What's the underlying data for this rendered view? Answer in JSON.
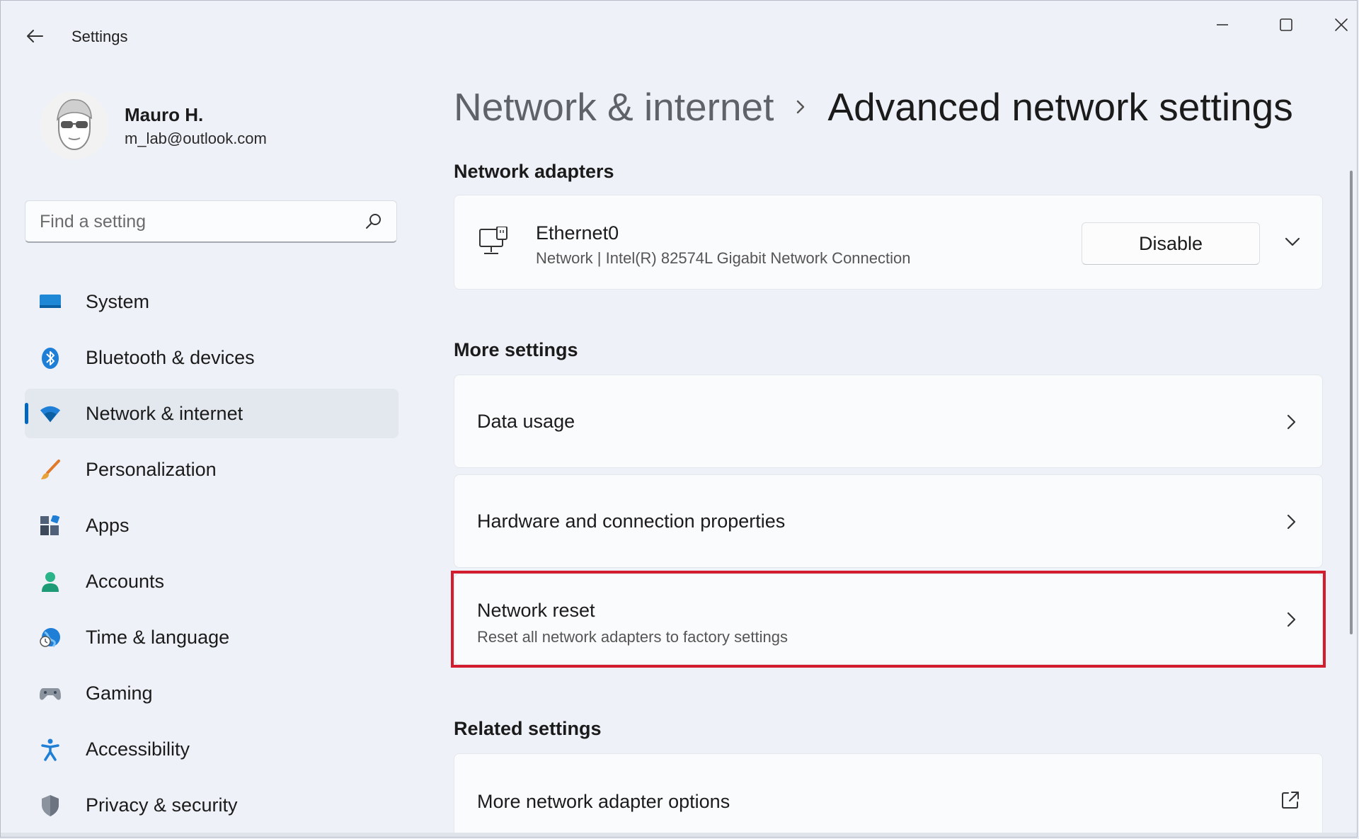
{
  "window": {
    "title": "Settings"
  },
  "profile": {
    "name": "Mauro H.",
    "email": "m_lab@outlook.com"
  },
  "search": {
    "placeholder": "Find a setting"
  },
  "sidebar": {
    "items": [
      {
        "label": "System",
        "icon": "system-icon",
        "active": false
      },
      {
        "label": "Bluetooth & devices",
        "icon": "bluetooth-icon",
        "active": false
      },
      {
        "label": "Network & internet",
        "icon": "wifi-icon",
        "active": true
      },
      {
        "label": "Personalization",
        "icon": "brush-icon",
        "active": false
      },
      {
        "label": "Apps",
        "icon": "apps-icon",
        "active": false
      },
      {
        "label": "Accounts",
        "icon": "person-icon",
        "active": false
      },
      {
        "label": "Time & language",
        "icon": "globe-clock-icon",
        "active": false
      },
      {
        "label": "Gaming",
        "icon": "gamepad-icon",
        "active": false
      },
      {
        "label": "Accessibility",
        "icon": "accessibility-icon",
        "active": false
      },
      {
        "label": "Privacy & security",
        "icon": "shield-icon",
        "active": false
      }
    ]
  },
  "breadcrumb": {
    "parent": "Network & internet",
    "current": "Advanced network settings"
  },
  "network_adapters": {
    "heading": "Network adapters",
    "adapter": {
      "name": "Ethernet0",
      "description": "Network | Intel(R) 82574L Gigabit Network Connection",
      "button_label": "Disable"
    }
  },
  "more_settings": {
    "heading": "More settings",
    "items": [
      {
        "title": "Data usage",
        "subtitle": ""
      },
      {
        "title": "Hardware and connection properties",
        "subtitle": ""
      },
      {
        "title": "Network reset",
        "subtitle": "Reset all network adapters to factory settings"
      }
    ]
  },
  "related_settings": {
    "heading": "Related settings",
    "items": [
      {
        "title": "More network adapter options"
      }
    ]
  },
  "colors": {
    "accent": "#0067c0",
    "highlight": "#d31c2d"
  }
}
